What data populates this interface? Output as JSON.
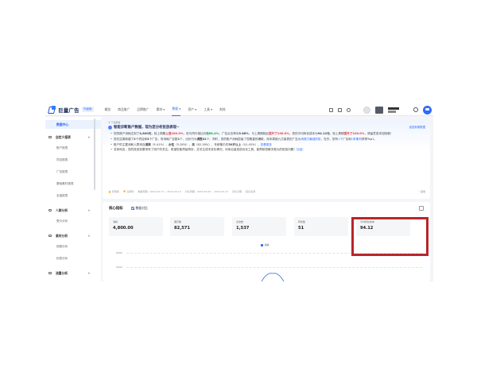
{
  "app": {
    "logo_text": "巨量广告",
    "logo_tag": "升级版"
  },
  "topnav": {
    "items": [
      {
        "label": "概览",
        "caret": false,
        "active": false
      },
      {
        "label": "商品推广",
        "caret": false,
        "active": false
      },
      {
        "label": "品牌推广",
        "caret": false,
        "active": false
      },
      {
        "label": "素材",
        "caret": true,
        "active": false
      },
      {
        "label": "数据",
        "caret": true,
        "active": true
      },
      {
        "label": "资产",
        "caret": true,
        "active": false
      },
      {
        "label": "工具",
        "caret": true,
        "active": false
      },
      {
        "label": "财务",
        "caret": false,
        "active": false
      }
    ]
  },
  "sidebar": {
    "active": "数据中心",
    "groups": [
      {
        "label": "自定义报表",
        "items": [
          "账户报表",
          "项目报表",
          "广告报表",
          "基础素材报表",
          "全量报表"
        ]
      },
      {
        "label": "人群分析",
        "items": [
          "受众分析"
        ]
      },
      {
        "label": "素材分析",
        "items": [
          "视频分析",
          "标签分析"
        ]
      },
      {
        "label": "流量分析",
        "items": []
      }
    ]
  },
  "report": {
    "small_label": "下载报告",
    "title": "智能诊断账户数据，现为您分析投放表现~",
    "link": "返回到原数据"
  },
  "bullet1": {
    "t1": "您的账户消耗达到了",
    "v1": "4,800元",
    "t2": "，较上周期",
    "v2": "上涨100.0%",
    "t3": "，但与同行相比仍",
    "v3": "低68.4%",
    "t4": "。广告点击率为",
    "v4": "5.86%",
    "t5": "，与上周期相比",
    "v5": "提升了100.0%",
    "t6": "。您的平均转化成本为",
    "v6": "94.12元",
    "t7": "，较上周期",
    "v7": "提升了100.0%",
    "t8": "，请留意成本控制哦！"
  },
  "bullet2": {
    "t1": "您在这周新建了",
    "v1": "2",
    "t2": "个项目和",
    "v2": "3",
    "t3": "个广告，有消耗广告数",
    "v3": "1",
    "t4": "个，出价行为",
    "v4": "调整41",
    "t5": "个。同时，您的账户消耗层级了您着重的爆款，而本周被九方量表的广告为",
    "v5": "消费力最强的前",
    "t6": "，在外，您有",
    "v6": "1个",
    "t7": "广告和",
    "v7": "1条素材",
    "t8": "获得Top1。"
  },
  "bullet3": {
    "t1": "账户的主要消耗人群来自",
    "v1": "湖南",
    "t2": "（9.41%），",
    "v2": "女性",
    "t3": "（5.28%），",
    "v3": "男",
    "t4": "（62.18%），年龄集中在",
    "v4": "50岁以上",
    "t5": "（41.45%），",
    "v5": "查看更多"
  },
  "bullet4": {
    "t1": "总体而言，您的投放效果带来了用户的关注，希望您能再接再厉，并关注成本变化情况，利用巨量投放优化工具，能帮助您解决更大的投放问题！",
    "v1": "加油！"
  },
  "report_footer": {
    "items": [
      "有帮助",
      "没帮助",
      "数据周期：2023-09-13 ~ 2023-09-19",
      "对比周期：2023-09-06 ~ 2023-09-12",
      "对比日期",
      "结论来源"
    ],
    "right": "回收"
  },
  "core": {
    "title": "核心指标",
    "checkbox_label": "数据对比",
    "cards": [
      {
        "label": "消耗",
        "value": "4,800.00"
      },
      {
        "label": "展示数",
        "value": "82,571"
      },
      {
        "label": "点击数",
        "value": "1,537"
      },
      {
        "label": "转化数",
        "value": "51"
      },
      {
        "label": "平均转化成本",
        "value": "94.12"
      }
    ],
    "legend": "消耗",
    "yticks": [
      "6000",
      "4500"
    ]
  },
  "colors": {
    "accent": "#2f6bff",
    "highlight": "#b7262b",
    "red": "#e23a3a",
    "green": "#16a34a"
  }
}
